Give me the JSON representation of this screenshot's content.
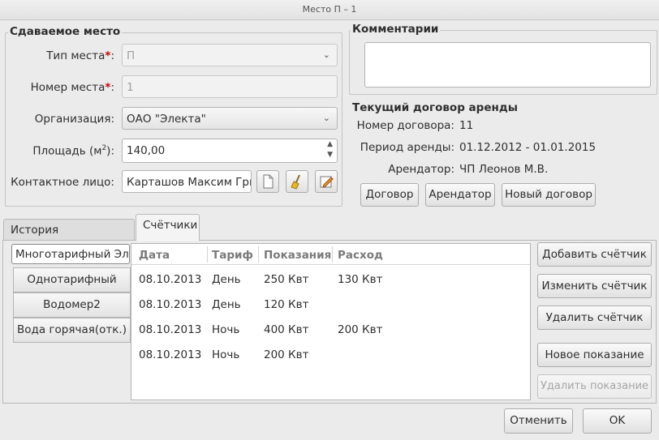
{
  "window": {
    "title": "Место П – 1"
  },
  "rental_place": {
    "group_title": "Сдаваемое место",
    "type_label": "Тип места",
    "type_value": "П",
    "number_label": "Номер места",
    "number_value": "1",
    "org_label": "Организация:",
    "org_value": "ОАО \"Электа\"",
    "area_label_pre": "Площадь (м",
    "area_label_sup": "2",
    "area_label_post": "):",
    "area_value": "140,00",
    "contact_label": "Контактное лицо:",
    "contact_value": "Карташов Максим Григ"
  },
  "comments": {
    "group_title": "Комментарии",
    "text": ""
  },
  "contract": {
    "title": "Текущий договор аренды",
    "number_label": "Номер договора:",
    "number_value": "11",
    "period_label": "Период аренды:",
    "period_value": "01.12.2012 - 01.01.2015",
    "tenant_label": "Арендатор:",
    "tenant_value": "ЧП Леонов М.В.",
    "btn_contract": "Договор",
    "btn_tenant": "Арендатор",
    "btn_new": "Новый договор"
  },
  "tabs": [
    {
      "label": "История арендаторов"
    },
    {
      "label": "Счётчики"
    }
  ],
  "meters": {
    "list": [
      "Многотарифный Эл.",
      "Однотарифный",
      "Водомер2",
      "Вода горячая(отк.)"
    ],
    "columns": [
      "Дата",
      "Тариф",
      "Показания",
      "Расход"
    ],
    "rows": [
      [
        "08.10.2013",
        "День",
        "250 Квт",
        "130 Квт"
      ],
      [
        "08.10.2013",
        "День",
        "120 Квт",
        ""
      ],
      [
        "08.10.2013",
        "Ночь",
        "400 Квт",
        "200 Квт"
      ],
      [
        "08.10.2013",
        "Ночь",
        "200 Квт",
        ""
      ]
    ],
    "btn_add": "Добавить счётчик",
    "btn_edit": "Изменить счётчик",
    "btn_delete": "Удалить счётчик",
    "btn_new_reading": "Новое показание",
    "btn_delete_reading": "Удалить показание"
  },
  "footer": {
    "cancel": "Отменить",
    "ok": "OK"
  },
  "icons": {
    "required_mark": "*",
    "combo_arrow": "chevron-down-icon"
  },
  "colors": {
    "required": "#cc0000",
    "window_bg": "#ebebeb"
  }
}
